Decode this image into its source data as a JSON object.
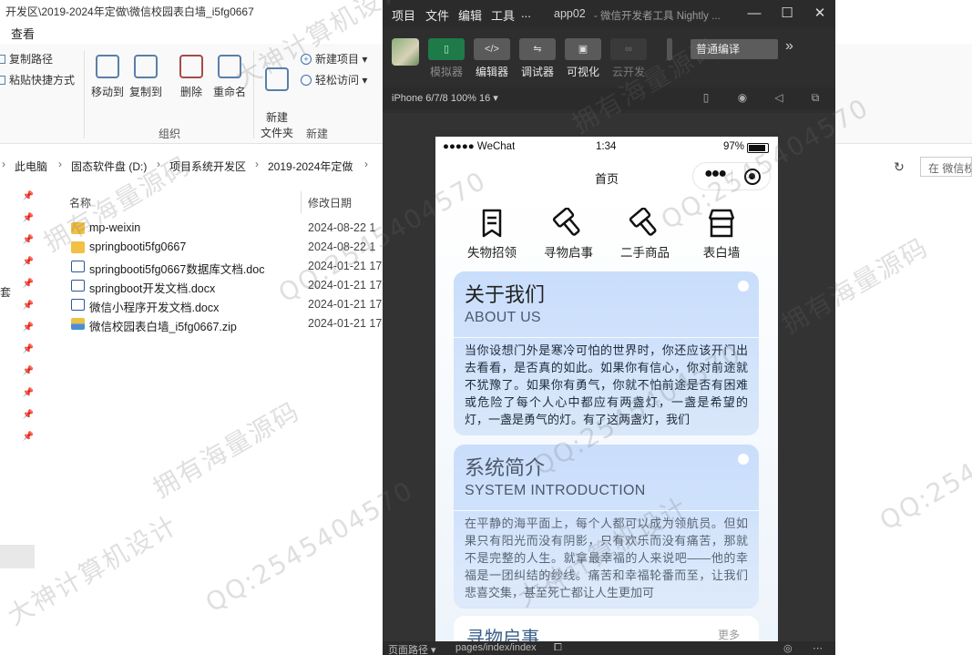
{
  "explorer": {
    "title": "开发区\\2019-2024年定做\\微信校园表白墙_i5fg0667",
    "menu_view": "查看",
    "ribbon": {
      "copy_path": "复制路径",
      "paste_shortcut": "粘贴快捷方式",
      "move_to": "移动到",
      "copy_to": "复制到",
      "delete": "删除",
      "rename": "重命名",
      "new_folder": "新建\n文件夹",
      "new_item": "新建项目 ▾",
      "easy_access": "轻松访问 ▾",
      "group_organize": "组织",
      "group_new": "新建"
    },
    "breadcrumb": [
      "此电脑",
      "固态软件盘 (D:)",
      "项目系统开发区",
      "2019-2024年定做"
    ],
    "search_placeholder": "在 微信校",
    "columns": {
      "name": "名称",
      "date": "修改日期"
    },
    "files": [
      {
        "name": "mp-weixin",
        "date": "2024-08-22 1",
        "type": "folder"
      },
      {
        "name": "springbooti5fg0667",
        "date": "2024-08-22 1",
        "type": "folder"
      },
      {
        "name": "springbooti5fg0667数据库文档.doc",
        "date": "2024-01-21 17",
        "type": "doc"
      },
      {
        "name": "springboot开发文档.docx",
        "date": "2024-01-21 17",
        "type": "doc"
      },
      {
        "name": "微信小程序开发文档.docx",
        "date": "2024-01-21 17",
        "type": "doc"
      },
      {
        "name": "微信校园表白墙_i5fg0667.zip",
        "date": "2024-01-21 17",
        "type": "zip"
      }
    ],
    "side_char": "套"
  },
  "devtools": {
    "menu": [
      "项目",
      "文件",
      "编辑",
      "工具",
      "..."
    ],
    "app_name": "app02",
    "subtitle": "- 微信开发者工具 Nightly ...",
    "toolbar": [
      {
        "label": "模拟器",
        "icon": "phone-icon",
        "state": "active"
      },
      {
        "label": "编辑器",
        "icon": "code-icon",
        "state": "normal"
      },
      {
        "label": "调试器",
        "icon": "sliders-icon",
        "state": "normal"
      },
      {
        "label": "可视化",
        "icon": "layout-icon",
        "state": "normal"
      },
      {
        "label": "云开发",
        "icon": "cloud-icon",
        "state": "dim"
      }
    ],
    "compile_mode": "普通编译",
    "more": "»",
    "device": "iPhone 6/7/8 100% 16 ▾",
    "status_path_label": "页面路径 ▾",
    "status_path": "pages/index/index"
  },
  "phone": {
    "carrier": "●●●●● WeChat",
    "time": "1:34",
    "battery": "97%",
    "nav_title": "首页",
    "quick_nav": [
      {
        "label": "失物招领",
        "icon": "bookmark-icon"
      },
      {
        "label": "寻物启事",
        "icon": "hammer-icon"
      },
      {
        "label": "二手商品",
        "icon": "hammer-icon"
      },
      {
        "label": "表白墙",
        "icon": "store-icon"
      }
    ],
    "about": {
      "title": "关于我们",
      "subtitle": "ABOUT US",
      "text": "当你设想门外是寒冷可怕的世界时，你还应该开门出去看看，是否真的如此。如果你有信心，你对前途就不犹豫了。如果你有勇气，你就不怕前途是否有困难或危险了每个人心中都应有两盏灯，一盏是希望的灯，一盏是勇气的灯。有了这两盏灯，我们"
    },
    "system": {
      "title": "系统简介",
      "subtitle": "SYSTEM INTRODUCTION",
      "text": "在平静的海平面上，每个人都可以成为领航员。但如果只有阳光而没有阴影，只有欢乐而没有痛苦，那就不是完整的人生。就拿最幸福的人来说吧——他的幸福是一团纠结的纱线。痛苦和幸福轮番而至，让我们悲喜交集，甚至死亡都让人生更加可"
    },
    "lost_found": {
      "title": "寻物启事",
      "more": "更多"
    }
  },
  "watermarks": {
    "qq": "QQ:2545404570",
    "brand": "拥有海量源码",
    "design": "大神计算机设计"
  },
  "colors": {
    "devtools_bg": "#2e2e2e",
    "card_blue": "#c9defc",
    "sim_green": "#1e7a48"
  }
}
